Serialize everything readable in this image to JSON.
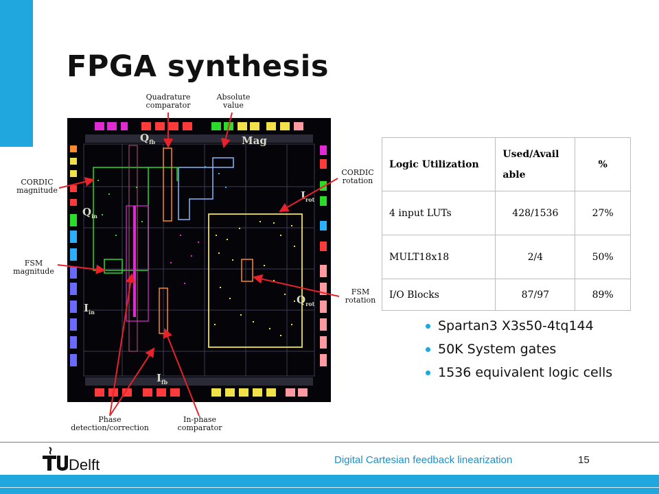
{
  "slide": {
    "title": "FPGA synthesis",
    "footer_text": "Digital Cartesian feedback linearization",
    "page_number": "15",
    "logo_text": "TUDelft",
    "accent_color": "#1fa7de"
  },
  "figure": {
    "annotations": {
      "quadrature_comparator": "Quadrature\ncomparator",
      "absolute_value": "Absolute\nvalue",
      "cordic_magnitude": "CORDIC\nmagnitude",
      "cordic_rotation": "CORDIC\nrotation",
      "fsm_magnitude": "FSM\nmagnitude",
      "fsm_rotation": "FSM\nrotation",
      "phase_detection": "Phase\ndetection/correction",
      "inphase_comparator": "In-phase\ncomparator"
    },
    "chip_labels": {
      "q_fb": "Q",
      "q_fb_sub": "fb",
      "mag": "Mag",
      "i_rot": "I",
      "i_rot_sub": "rot",
      "q_in": "Q",
      "q_in_sub": "in",
      "i_in": "I",
      "i_in_sub": "in",
      "q_rot": "Q",
      "q_rot_sub": "rot",
      "i_fb": "I",
      "i_fb_sub": "fb"
    }
  },
  "table": {
    "headers": [
      "Logic Utilization",
      "Used/Avail able",
      "%"
    ],
    "rows": [
      [
        "4 input LUTs",
        "428/1536",
        "27%"
      ],
      [
        "MULT18x18",
        "2/4",
        "50%"
      ],
      [
        "I/O Blocks",
        "87/97",
        "89%"
      ]
    ]
  },
  "bullets": [
    "Spartan3 X3s50-4tq144",
    "50K System gates",
    "1536 equivalent logic cells"
  ]
}
